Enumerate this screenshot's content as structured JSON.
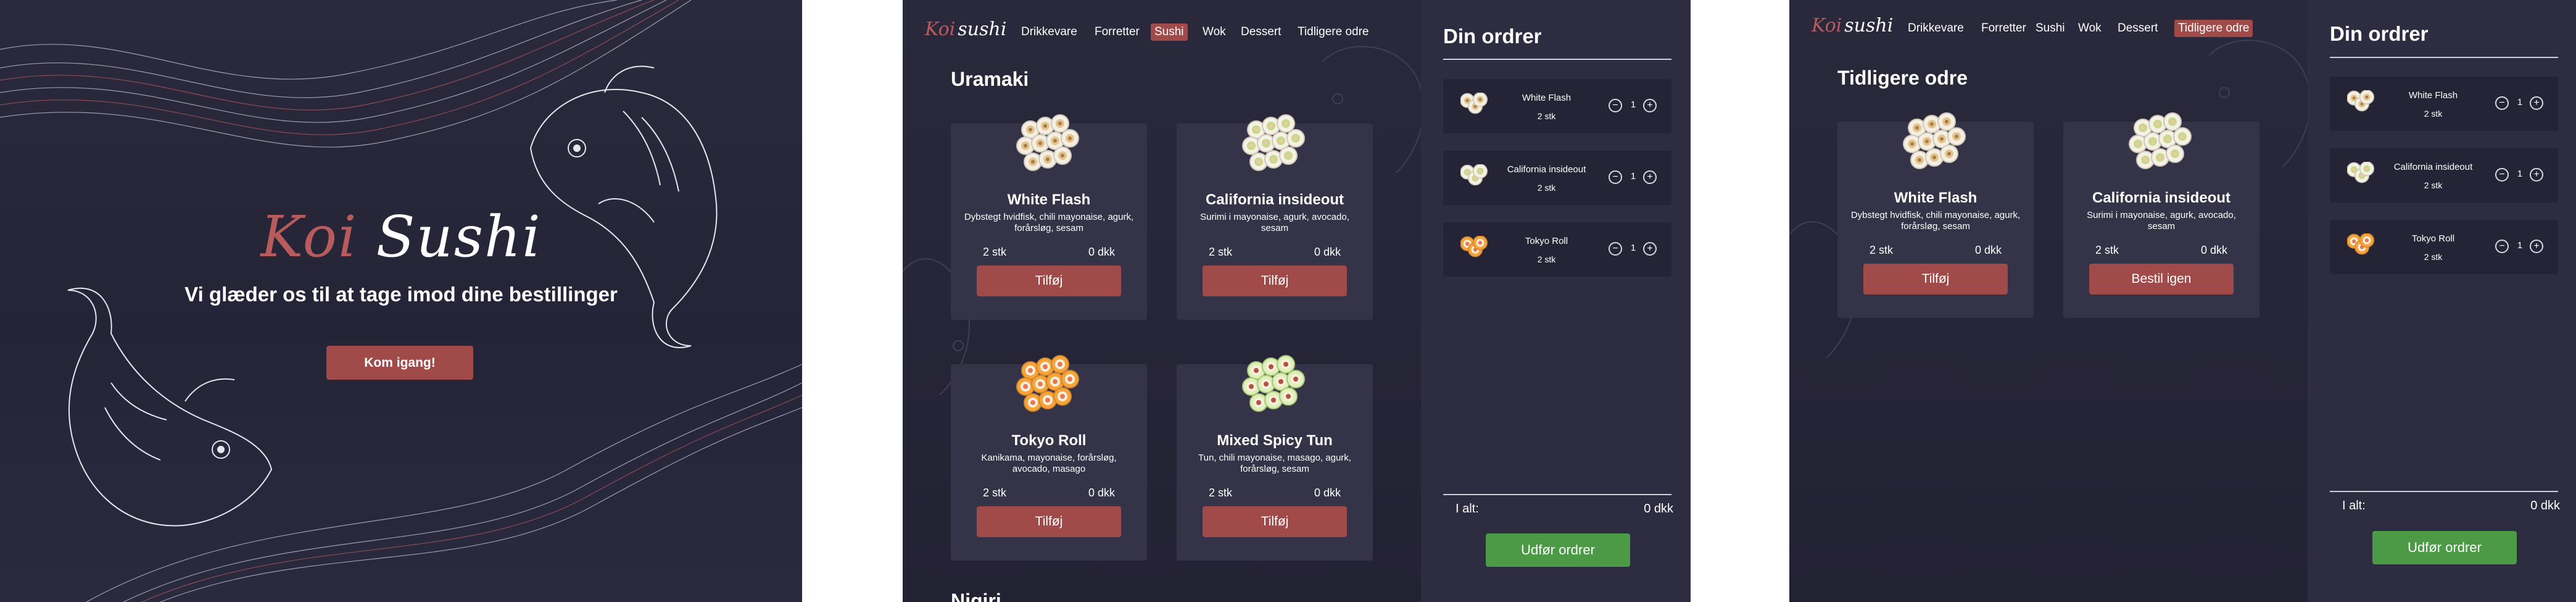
{
  "landing": {
    "brand_koi": "Koi",
    "brand_sushi": "Sushi",
    "tagline": "Vi glæder os til at tage imod dine bestillinger",
    "cta_label": "Kom igang!"
  },
  "menu_screen": {
    "logo_koi": "Koi",
    "logo_sushi": "sushi",
    "nav": [
      "Drikkevare",
      "Forretter",
      "Sushi",
      "Wok",
      "Dessert",
      "Tidligere odre"
    ],
    "active_nav": "Sushi",
    "section_title": "Uramaki",
    "next_section_title": "Nigiri",
    "products": [
      {
        "name": "White Flash",
        "desc": "Dybstegt hvidfisk, chili mayonaise, agurk, forårsløg, sesam",
        "qty": "2 stk",
        "price": "0 dkk",
        "button": "Tilføj",
        "icon": "sushi-white-icon"
      },
      {
        "name": "California insideout",
        "desc": "Surimi i mayonaise, agurk, avocado, sesam",
        "qty": "2 stk",
        "price": "0 dkk",
        "button": "Tilføj",
        "icon": "sushi-california-icon"
      },
      {
        "name": "Tokyo Roll",
        "desc": "Kanikama, mayonaise, forårsløg, avocado, masago",
        "qty": "2 stk",
        "price": "0 dkk",
        "button": "Tilføj",
        "icon": "sushi-tokyo-icon"
      },
      {
        "name": "Mixed Spicy Tun",
        "desc": "Tun, chili mayonaise, masago, agurk, forårsløg, sesam",
        "qty": "2 stk",
        "price": "0 dkk",
        "button": "Tilføj",
        "icon": "sushi-spicy-icon"
      }
    ],
    "order": {
      "heading": "Din ordrer",
      "items": [
        {
          "name": "White Flash",
          "count": "2 stk",
          "quantity": "1"
        },
        {
          "name": "California insideout",
          "count": "2 stk",
          "quantity": "1"
        },
        {
          "name": "Tokyo Roll",
          "count": "2 stk",
          "quantity": "1"
        }
      ],
      "total_label": "I alt:",
      "total_value": "0 dkk",
      "submit_label": "Udfør ordrer"
    }
  },
  "history_screen": {
    "logo_koi": "Koi",
    "logo_sushi": "sushi",
    "nav": [
      "Drikkevare",
      "Forretter",
      "Sushi",
      "Wok",
      "Dessert",
      "Tidligere odre"
    ],
    "active_nav": "Tidligere odre",
    "section_title": "Tidligere odre",
    "products": [
      {
        "name": "White Flash",
        "desc": "Dybstegt hvidfisk, chili mayonaise, agurk, forårsløg, sesam",
        "qty": "2 stk",
        "price": "0 dkk",
        "button": "Tilføj"
      },
      {
        "name": "California insideout",
        "desc": "Surimi i mayonaise, agurk, avocado, sesam",
        "qty": "2 stk",
        "price": "0 dkk",
        "button": "Bestil igen"
      }
    ],
    "order": {
      "heading": "Din ordrer",
      "items": [
        {
          "name": "White Flash",
          "count": "2 stk",
          "quantity": "1"
        },
        {
          "name": "California insideout",
          "count": "2 stk",
          "quantity": "1"
        },
        {
          "name": "Tokyo Roll",
          "count": "2 stk",
          "quantity": "1"
        }
      ],
      "total_label": "I alt:",
      "total_value": "0 dkk",
      "submit_label": "Udfør ordrer"
    }
  },
  "colors": {
    "background": "#262538",
    "accent_red": "#a04a4a",
    "accent_green": "#4c9a45",
    "card": "#343348"
  }
}
